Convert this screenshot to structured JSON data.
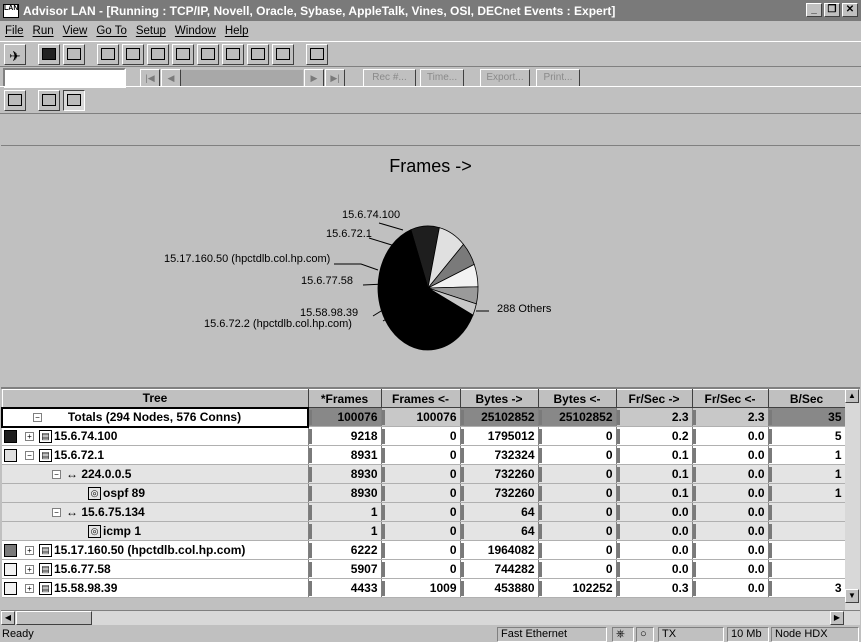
{
  "window": {
    "title": "Advisor LAN - [Running : TCP/IP, Novell, Oracle, Sybase, AppleTalk, Vines, OSI, DECnet Events : Expert]",
    "app_icon_text": "LAN",
    "minimize_glyph": "_",
    "restore_glyph": "❐",
    "close_glyph": "✕"
  },
  "menu": [
    "File",
    "Run",
    "View",
    "Go To",
    "Setup",
    "Window",
    "Help"
  ],
  "navbar": {
    "first_glyph": "|◀",
    "prev_glyph": "◀",
    "next_glyph": "▶",
    "last_glyph": "▶|",
    "record_label": "Rec #...",
    "time_label": "Time...",
    "export_label": "Export...",
    "print_label": "Print..."
  },
  "chart": {
    "title": "Frames ->",
    "labels": [
      "15.6.74.100",
      "15.6.72.1",
      "15.17.160.50 (hpctdlb.col.hp.com)",
      "15.6.77.58",
      "15.58.98.39",
      "15.6.72.2 (hpctdlb.col.hp.com)",
      "288 Others"
    ]
  },
  "chart_data": {
    "type": "pie",
    "title": "Frames ->",
    "slices": [
      {
        "label": "15.6.74.100",
        "value": 9218,
        "color": "#1e1e1e"
      },
      {
        "label": "15.6.72.1",
        "value": 8931,
        "color": "#e0e0e0"
      },
      {
        "label": "15.17.160.50 (hpctdlb.col.hp.com)",
        "value": 6222,
        "color": "#7a7a7a"
      },
      {
        "label": "15.6.77.58",
        "value": 5907,
        "color": "#f2f2f2"
      },
      {
        "label": "15.58.98.39",
        "value": 4433,
        "color": "#9a9a9a"
      },
      {
        "label": "15.6.72.2 (hpctdlb.col.hp.com)",
        "value": 3100,
        "color": "#c8c8c8"
      },
      {
        "label": "288 Others",
        "value": 62265,
        "color": "#000000"
      }
    ]
  },
  "table": {
    "columns": [
      "Tree",
      "*Frames",
      "Frames <-",
      "Bytes ->",
      "Bytes <-",
      "Fr/Sec ->",
      "Fr/Sec <-",
      "B/Sec"
    ],
    "scroll_up_glyph": "▲",
    "scroll_down_glyph": "▼",
    "rows": [
      {
        "kind": "totals",
        "tree": "Totals (294 Nodes, 576 Conns)",
        "cells": [
          "100076",
          "100076",
          "25102852",
          "25102852",
          "2.3",
          "2.3",
          "35"
        ]
      },
      {
        "kind": "node",
        "swatch": "#1e1e1e",
        "tree": "15.6.74.100",
        "cells": [
          "9218",
          "0",
          "1795012",
          "0",
          "0.2",
          "0.0",
          "5"
        ]
      },
      {
        "kind": "node",
        "swatch": "#e0e0e0",
        "expand": "−",
        "tree": "15.6.72.1",
        "cells": [
          "8931",
          "0",
          "732324",
          "0",
          "0.1",
          "0.0",
          "1"
        ]
      },
      {
        "kind": "sub",
        "expand": "−",
        "tree": "↔ 224.0.0.5",
        "cells": [
          "8930",
          "0",
          "732260",
          "0",
          "0.1",
          "0.0",
          "1"
        ]
      },
      {
        "kind": "sub2",
        "tree": "ospf 89",
        "cells": [
          "8930",
          "0",
          "732260",
          "0",
          "0.1",
          "0.0",
          "1"
        ]
      },
      {
        "kind": "sub",
        "expand": "−",
        "tree": "↔ 15.6.75.134",
        "cells": [
          "1",
          "0",
          "64",
          "0",
          "0.0",
          "0.0",
          ""
        ]
      },
      {
        "kind": "sub2",
        "tree": "icmp 1",
        "cells": [
          "1",
          "0",
          "64",
          "0",
          "0.0",
          "0.0",
          ""
        ]
      },
      {
        "kind": "node",
        "swatch": "#7a7a7a",
        "tree": "15.17.160.50 (hpctdlb.col.hp.com)",
        "cells": [
          "6222",
          "0",
          "1964082",
          "0",
          "0.0",
          "0.0",
          ""
        ]
      },
      {
        "kind": "node",
        "swatch": "#f2f2f2",
        "tree": "15.6.77.58",
        "cells": [
          "5907",
          "0",
          "744282",
          "0",
          "0.0",
          "0.0",
          ""
        ]
      },
      {
        "kind": "node",
        "swatch": "#f2f2f2",
        "tree": "15.58.98.39",
        "cells": [
          "4433",
          "1009",
          "453880",
          "102252",
          "0.3",
          "0.0",
          "3"
        ]
      }
    ]
  },
  "hscroll": {
    "left_glyph": "◀",
    "right_glyph": "▶"
  },
  "status": {
    "text": "Ready",
    "network": "Fast Ethernet",
    "tx": "TX",
    "speed": "10 Mb",
    "mode": "Node HDX"
  }
}
